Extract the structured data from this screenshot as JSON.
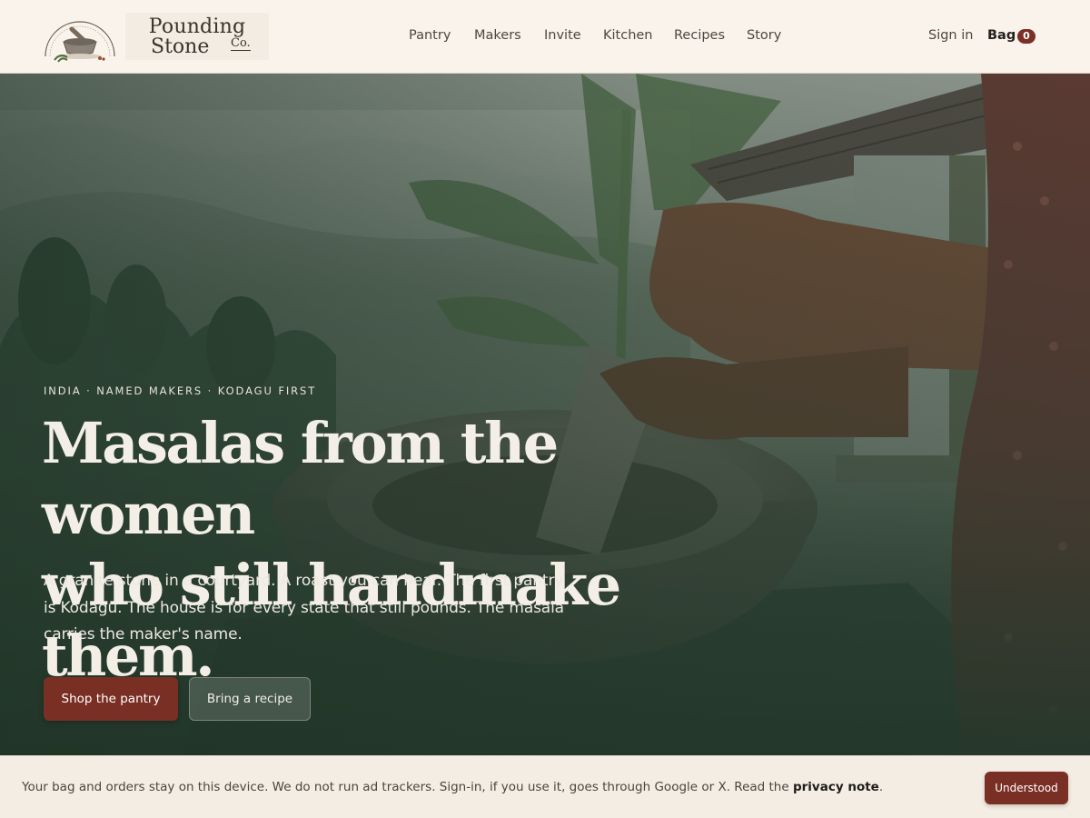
{
  "brand": {
    "line1": "Pounding",
    "line2": "Stone",
    "suffix": "Co."
  },
  "nav": {
    "items": [
      {
        "label": "Pantry"
      },
      {
        "label": "Makers"
      },
      {
        "label": "Invite"
      },
      {
        "label": "Kitchen"
      },
      {
        "label": "Recipes"
      },
      {
        "label": "Story"
      }
    ],
    "sign_in": "Sign in",
    "bag_label": "Bag",
    "bag_count": "0"
  },
  "hero": {
    "eyebrow": "INDIA · NAMED MAKERS · KODAGU FIRST",
    "headline_line1": "Masalas from the women",
    "headline_line2": "who still handmake them.",
    "subcopy": "A granite stone in a courtyard. A roast you can hear. The first pantry is Kodagu. The house is for every state that still pounds. The masala carries the maker's name.",
    "primary_cta": "Shop the pantry",
    "secondary_cta": "Bring a recipe"
  },
  "notice": {
    "text_before": "Your bag and orders stay on this device. We do not run ad trackers. Sign-in, if you use it, goes through Google or X. Read the ",
    "link_label": "privacy note",
    "text_after": ".",
    "dismiss_label": "Understood"
  },
  "colors": {
    "accent": "#7a2f25",
    "header_bg": "#f9f3eb",
    "hero_overlay": "#2f4437",
    "notice_bg": "#f4ede3"
  },
  "icons": [
    "mortar-logo-icon"
  ]
}
